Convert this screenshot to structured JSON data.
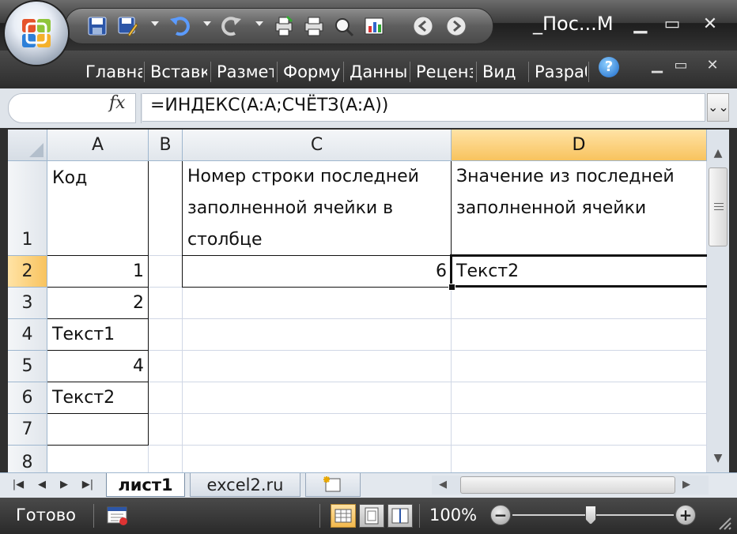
{
  "window": {
    "title": "_Пос...M",
    "controls": [
      "minimize-icon",
      "restore-icon",
      "close-icon"
    ]
  },
  "quick_access": [
    "save-icon",
    "save-as-icon",
    "undo-icon",
    "redo-icon",
    "print-preview-icon",
    "print-icon",
    "find-icon",
    "insert-chart-icon",
    "back-icon",
    "forward-icon"
  ],
  "ribbon": {
    "tabs": [
      "Главная",
      "Вставка",
      "Разметка",
      "Формулы",
      "Данные",
      "Рецензирование",
      "Вид",
      "Разработчик"
    ],
    "help_label": "?"
  },
  "formula_bar": {
    "fx_label": "fx",
    "formula": "=ИНДЕКС(A:A;СЧЁТЗ(A:A))",
    "expand_label": "¥"
  },
  "grid": {
    "columns": [
      "A",
      "B",
      "C",
      "D"
    ],
    "selected_column": "D",
    "rows": [
      "1",
      "2",
      "3",
      "4",
      "5",
      "6",
      "7",
      "8"
    ],
    "selected_row": "2",
    "cells": {
      "A1": "Код",
      "C1": "Номер строки последней заполненной ячейки в столбце",
      "D1": "Значение из последней заполненной ячейки",
      "A2": "1",
      "C2": "6",
      "D2": "Текст2",
      "A3": "2",
      "A4": "Текст1",
      "A5": "4",
      "A6": "Текст2"
    }
  },
  "sheets": {
    "tabs": [
      "лист1",
      "excel2.ru"
    ],
    "active": "лист1",
    "new_sheet_icon": "insert-sheet-icon"
  },
  "status_bar": {
    "status": "Готово",
    "zoom": "100%",
    "zoom_minus": "−",
    "zoom_plus": "+"
  },
  "colors": {
    "selected_header": "#f8c35e",
    "grid_line": "#d0d7e5",
    "header_border": "#9eb6ce"
  }
}
